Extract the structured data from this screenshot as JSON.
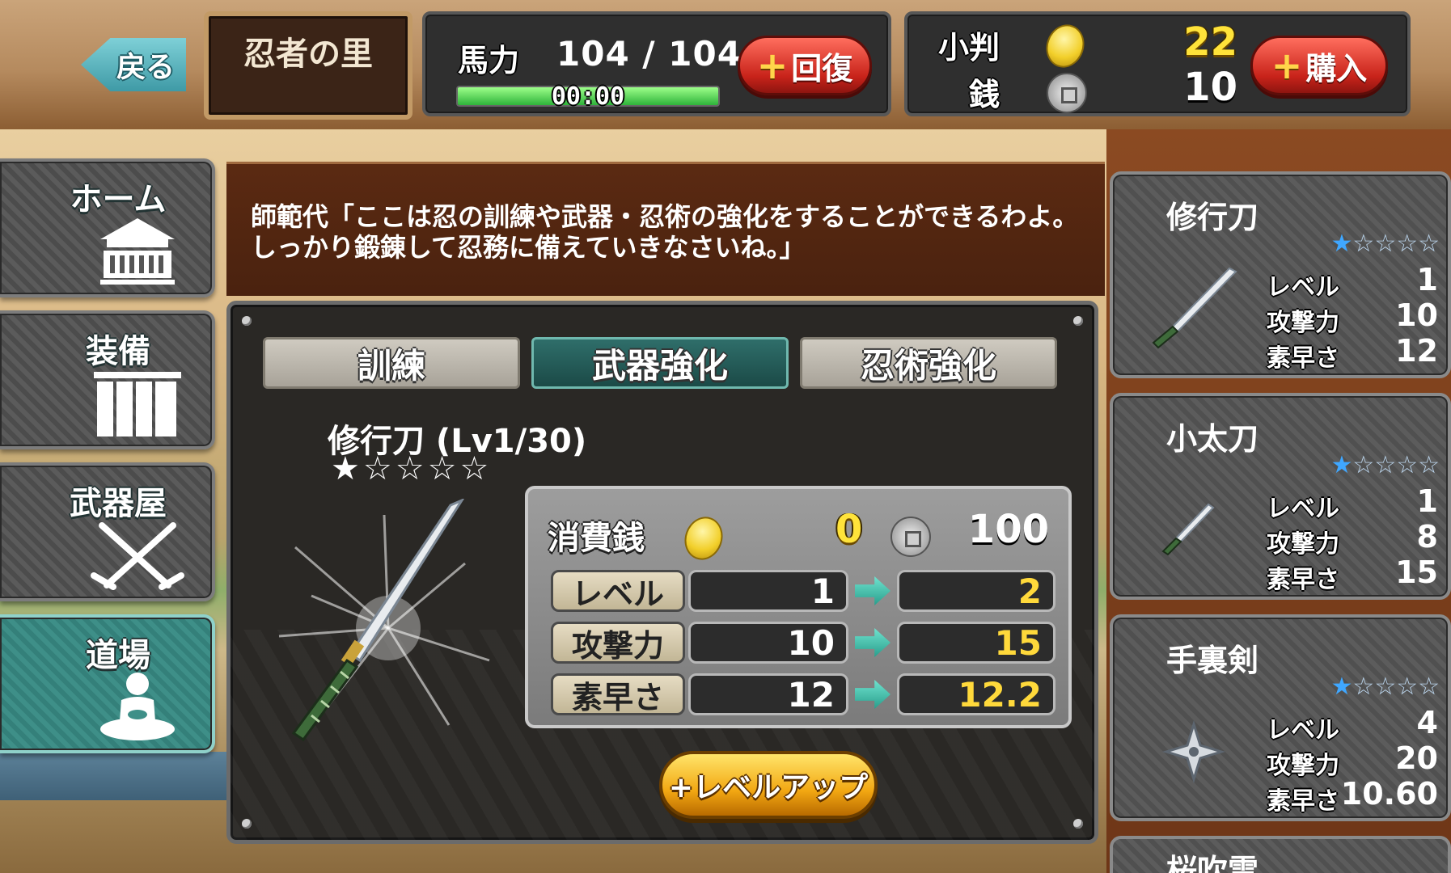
{
  "header": {
    "back_label": "戻る",
    "location": "忍者の里",
    "stamina": {
      "label": "馬力",
      "value": "104 / 104",
      "fraction": 1.0,
      "timer": "00:00",
      "recover_label": "回復"
    },
    "currency": {
      "koban_label": "小判",
      "koban_value": "22",
      "zeni_label": "銭",
      "zeni_value": "10",
      "buy_label": "購入"
    }
  },
  "nav": {
    "items": [
      {
        "label": "ホーム",
        "icon": "house-icon"
      },
      {
        "label": "装備",
        "icon": "curtain-icon"
      },
      {
        "label": "武器屋",
        "icon": "crossed-swords-icon"
      },
      {
        "label": "道場",
        "icon": "meditation-icon",
        "active": true
      }
    ]
  },
  "speech": "師範代「ここは忍の訓練や武器・忍術の強化をすることができるわよ。しっかり鍛錬して忍務に備えていきなさいね。」",
  "tabs": [
    {
      "label": "訓練"
    },
    {
      "label": "武器強化",
      "active": true
    },
    {
      "label": "忍術強化"
    }
  ],
  "selected_weapon": {
    "title": "修行刀 (Lv1/30)",
    "stars": "★☆☆☆☆",
    "rarity": 1,
    "cost": {
      "label": "消費銭",
      "koban": "0",
      "zeni": "100"
    },
    "stats": [
      {
        "label": "レベル",
        "current": "1",
        "next": "2"
      },
      {
        "label": "攻撃力",
        "current": "10",
        "next": "15"
      },
      {
        "label": "素早さ",
        "current": "12",
        "next": "12.2"
      }
    ],
    "levelup_label": "+レベルアップ"
  },
  "weapon_list": [
    {
      "name": "修行刀",
      "rarity": 1,
      "stars_filled": "★",
      "stars_empty": "☆☆☆☆",
      "icon": "katana-icon",
      "stats": [
        {
          "label": "レベル",
          "value": "1"
        },
        {
          "label": "攻撃力",
          "value": "10"
        },
        {
          "label": "素早さ",
          "value": "12"
        }
      ]
    },
    {
      "name": "小太刀",
      "rarity": 1,
      "stars_filled": "★",
      "stars_empty": "☆☆☆☆",
      "icon": "short-sword-icon",
      "stats": [
        {
          "label": "レベル",
          "value": "1"
        },
        {
          "label": "攻撃力",
          "value": "8"
        },
        {
          "label": "素早さ",
          "value": "15"
        }
      ]
    },
    {
      "name": "手裏剣",
      "rarity": 1,
      "stars_filled": "★",
      "stars_empty": "☆☆☆☆",
      "icon": "shuriken-icon",
      "stats": [
        {
          "label": "レベル",
          "value": "4"
        },
        {
          "label": "攻撃力",
          "value": "20"
        },
        {
          "label": "素早さ",
          "value": "10.60"
        }
      ]
    },
    {
      "name": "桜吹雪"
    }
  ],
  "colors": {
    "accent_teal": "#2f6e6a",
    "gold": "#ffd93b",
    "red_button": "#c8231a",
    "star_blue": "#3fa7ff"
  }
}
